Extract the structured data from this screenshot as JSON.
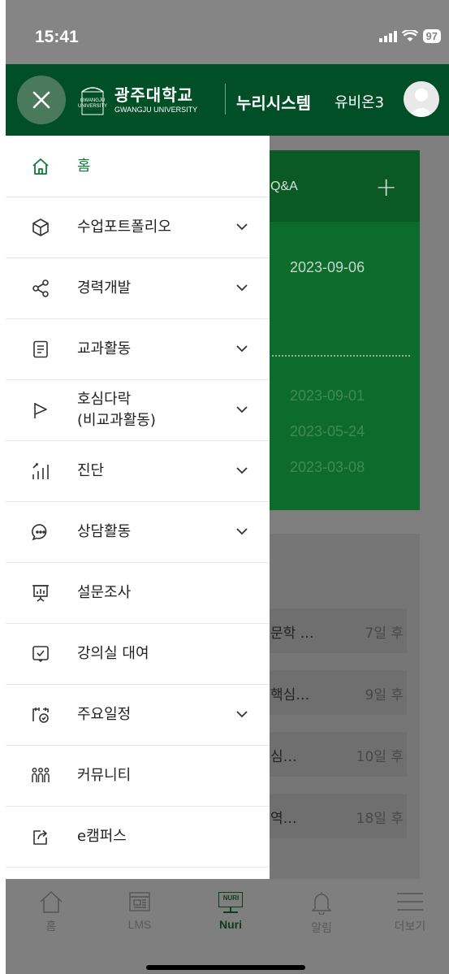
{
  "status_bar": {
    "time": "15:41",
    "battery": "97"
  },
  "header": {
    "logo_kr": "광주대학교",
    "logo_en": "GWANGJU UNIVERSITY",
    "logo_mark_text": "GWANGJU UNIVERSITY",
    "system_name": "누리시스템",
    "user_name": "유비온3"
  },
  "background": {
    "card_title": "Q&A",
    "dates": [
      "2023-09-06",
      "2023-09-01",
      "2023-05-24",
      "2023-03-08"
    ],
    "items": [
      {
        "text": "문학 …",
        "days": "7일 후"
      },
      {
        "text": "핵심…",
        "days": "9일 후"
      },
      {
        "text": "심…",
        "days": "10일 후"
      },
      {
        "text": "역…",
        "days": "18일 후"
      }
    ]
  },
  "menu": {
    "items": [
      {
        "label": "홈",
        "icon": "home-icon",
        "active": true,
        "expandable": false
      },
      {
        "label": "수업포트폴리오",
        "icon": "cube-icon",
        "expandable": true
      },
      {
        "label": "경력개발",
        "icon": "share-icon",
        "expandable": true
      },
      {
        "label": "교과활동",
        "icon": "document-icon",
        "expandable": true
      },
      {
        "label": "호심다락\n(비교과활동)",
        "icon": "flag-icon",
        "expandable": true
      },
      {
        "label": "진단",
        "icon": "bar-chart-icon",
        "expandable": true
      },
      {
        "label": "상담활동",
        "icon": "chat-icon",
        "expandable": true
      },
      {
        "label": "설문조사",
        "icon": "survey-icon",
        "expandable": false
      },
      {
        "label": "강의실 대여",
        "icon": "checkbox-icon",
        "expandable": false
      },
      {
        "label": "주요일정",
        "icon": "calendar-icon",
        "expandable": true
      },
      {
        "label": "커뮤니티",
        "icon": "community-icon",
        "expandable": false
      },
      {
        "label": "e캠퍼스",
        "icon": "external-link-icon",
        "expandable": false
      }
    ]
  },
  "tabbar": {
    "tabs": [
      {
        "label": "홈",
        "icon": "home-icon"
      },
      {
        "label": "LMS",
        "icon": "lms-icon"
      },
      {
        "label": "Nuri",
        "icon": "nuri-icon",
        "icon_text": "NURI",
        "active": true
      },
      {
        "label": "알림",
        "icon": "bell-icon"
      },
      {
        "label": "더보기",
        "icon": "menu-icon"
      }
    ]
  },
  "colors": {
    "brand_green": "#004f26",
    "active_green": "#0e7a3a"
  }
}
